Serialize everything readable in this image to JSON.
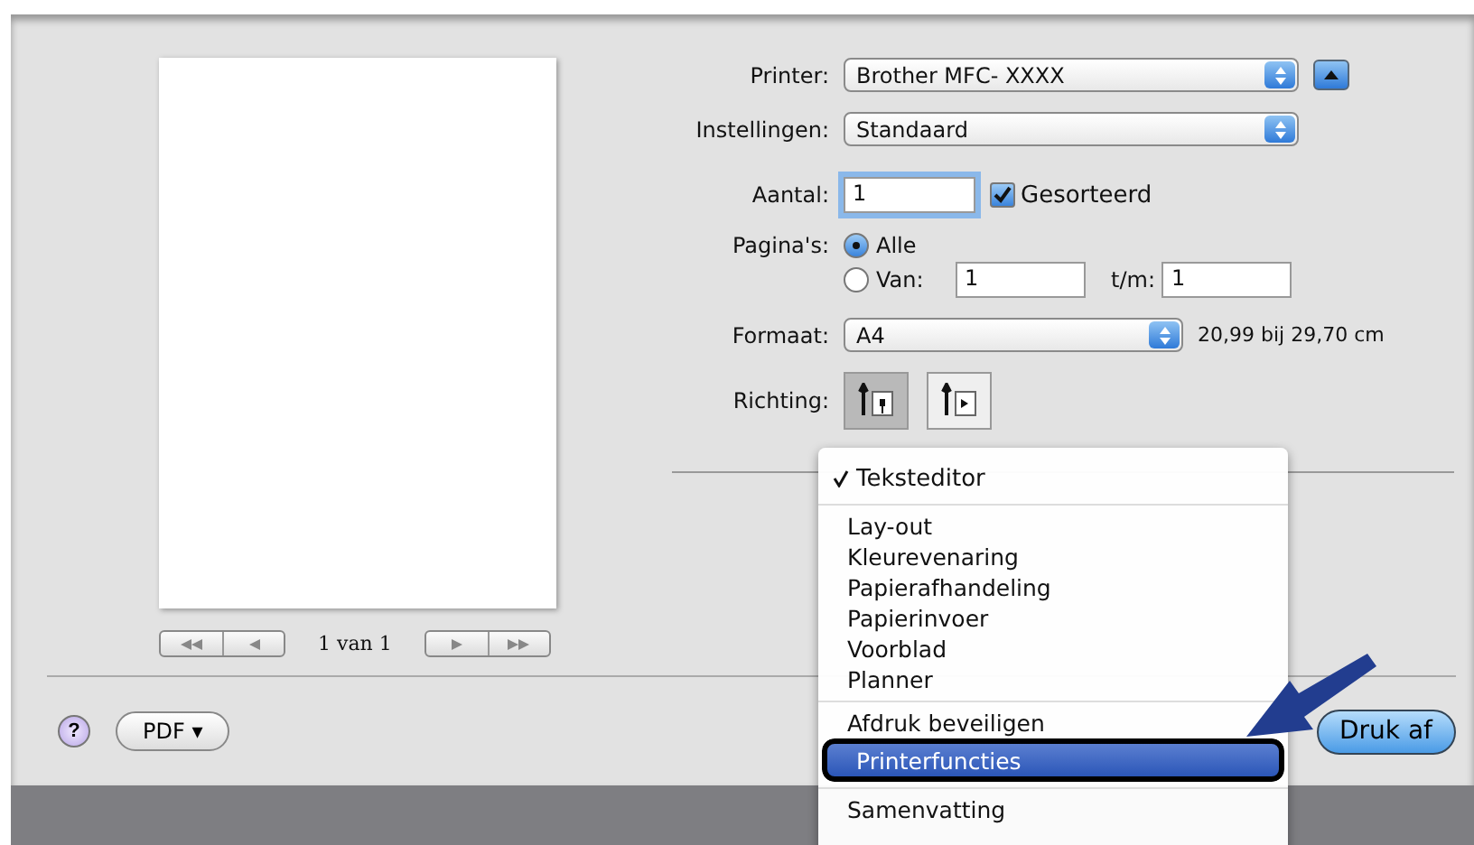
{
  "preview": {
    "page_indicator": "1 van 1"
  },
  "form": {
    "printer": {
      "label": "Printer:",
      "value": "Brother MFC- XXXX"
    },
    "preset": {
      "label": "Instellingen:",
      "value": "Standaard"
    },
    "copies": {
      "label": "Aantal:",
      "value": "1"
    },
    "collated": {
      "label": "Gesorteerd",
      "checked": true
    },
    "pages": {
      "label": "Pagina's:",
      "options": [
        {
          "label": "Alle",
          "selected": true
        },
        {
          "label": "Van:",
          "selected": false
        }
      ],
      "from": "1",
      "to_label": "t/m:",
      "to": "1"
    },
    "paper_size": {
      "label": "Formaat:",
      "value": "A4",
      "dimensions": "20,99 bij 29,70 cm"
    },
    "orientation": {
      "label": "Richting:",
      "options": [
        {
          "kind": "portrait",
          "selected": true
        },
        {
          "kind": "landscape",
          "selected": false
        }
      ]
    }
  },
  "menu": {
    "sections": [
      [
        {
          "label": "Teksteditor",
          "checked": true,
          "highlighted": false
        }
      ],
      [
        {
          "label": "Lay-out",
          "checked": false,
          "highlighted": false
        },
        {
          "label": "Kleurevenaring",
          "checked": false,
          "highlighted": false
        },
        {
          "label": "Papierafhandeling",
          "checked": false,
          "highlighted": false
        },
        {
          "label": "Papierinvoer",
          "checked": false,
          "highlighted": false
        },
        {
          "label": "Voorblad",
          "checked": false,
          "highlighted": false
        },
        {
          "label": "Planner",
          "checked": false,
          "highlighted": false
        }
      ],
      [
        {
          "label": "Afdruk beveiligen",
          "checked": false,
          "highlighted": false
        },
        {
          "label": "Printerfuncties",
          "checked": false,
          "highlighted": true
        }
      ],
      [
        {
          "label": "Samenvatting",
          "checked": false,
          "highlighted": false
        }
      ]
    ]
  },
  "footer": {
    "help": "?",
    "pdf": "PDF ▾",
    "print": "Druk af"
  }
}
